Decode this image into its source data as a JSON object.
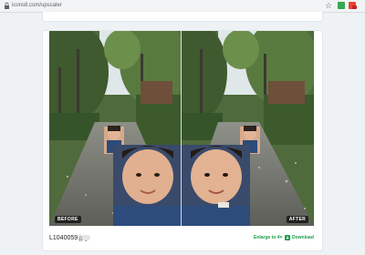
{
  "browser": {
    "url": "icons8.com/upscaler"
  },
  "comparison": {
    "before_label": "BEFORE",
    "after_label": "AFTER"
  },
  "file": {
    "name": "L1040059.jpg"
  },
  "actions": {
    "enlarge_label": "Enlarge to 4×",
    "download_label": "Download"
  },
  "colors": {
    "accent_green": "#1e9e4a",
    "page_background": "#eef2f5"
  },
  "icons": [
    "lock-icon",
    "star-icon",
    "extension-icon",
    "download-icon"
  ]
}
